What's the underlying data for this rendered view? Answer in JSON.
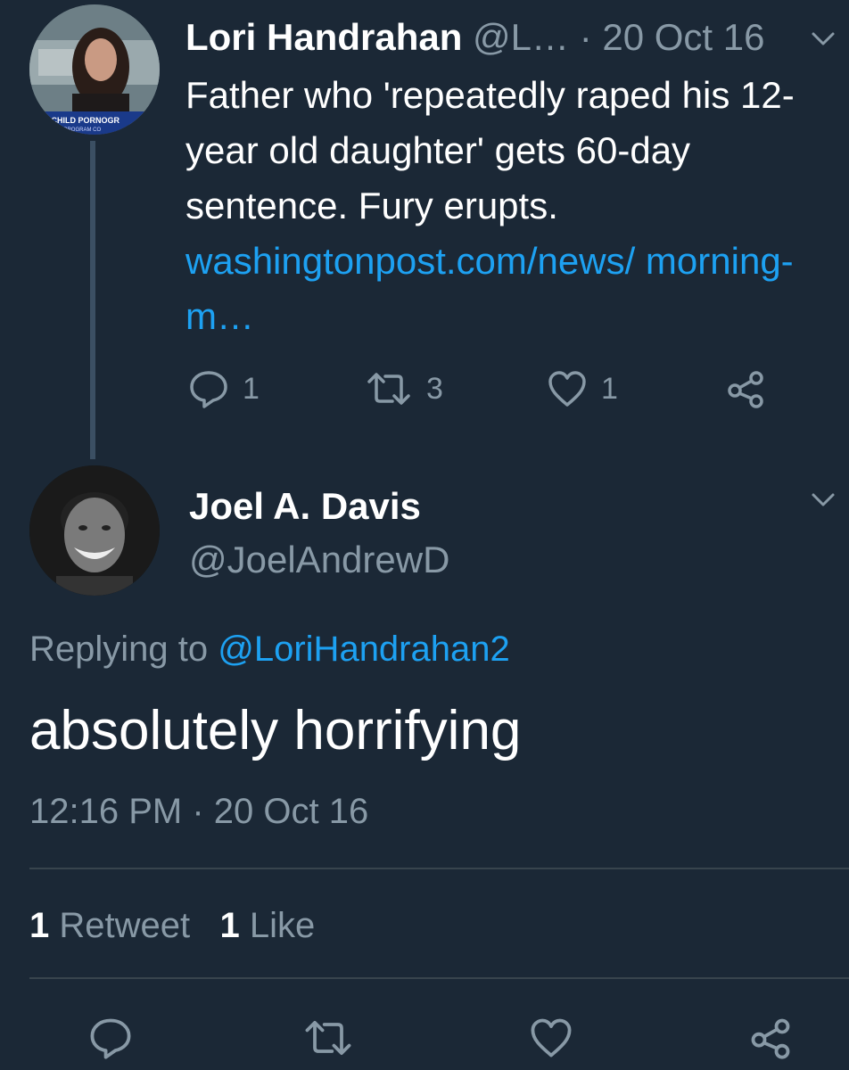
{
  "parent_tweet": {
    "author_name": "Lori Handrahan",
    "author_handle": "@L…",
    "separator": " · ",
    "date": "20 Oct 16",
    "avatar_caption_line1": "ING CHILD PORNOGR",
    "avatar_caption_line2": "OWER\" PROGRAM CO",
    "text": "Father who 'repeatedly raped his 12-year old daughter' gets 60-day sentence. Fury erupts.",
    "link": "washingtonpost.com/news/ morning-m…",
    "actions": {
      "reply_count": "1",
      "retweet_count": "3",
      "like_count": "1"
    }
  },
  "reply_tweet": {
    "author_name": "Joel A. Davis",
    "author_handle": "@JoelAndrewD",
    "replying_prefix": "Replying to",
    "replying_to": "@LoriHandrahan2",
    "text": "absolutely horrifying",
    "timestamp": "12:16 PM · 20 Oct 16",
    "stats": {
      "retweet_num": "1",
      "retweet_label": "Retweet",
      "like_num": "1",
      "like_label": "Like"
    }
  },
  "icons": {
    "reply": "reply-icon",
    "retweet": "retweet-icon",
    "like": "heart-icon",
    "share": "share-icon",
    "menu": "chevron-down-icon"
  },
  "colors": {
    "background": "#1b2836",
    "text_primary": "#ffffff",
    "text_secondary": "#8899a6",
    "link": "#1da1f2",
    "divider": "#38444d"
  }
}
